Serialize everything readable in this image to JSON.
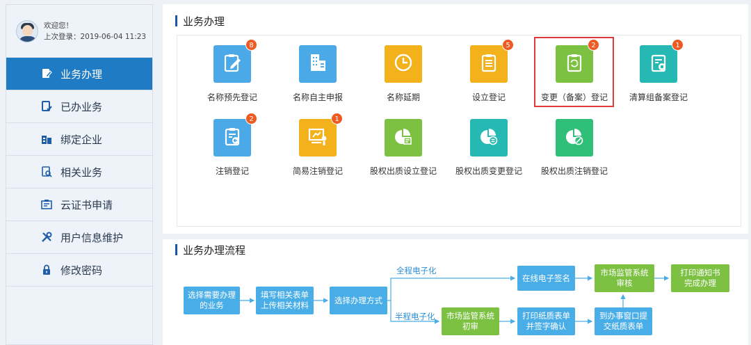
{
  "user": {
    "welcome": "欢迎您！",
    "last_login": "上次登录：2019-06-04 11:23"
  },
  "sidebar": {
    "items": [
      {
        "label": "业务办理",
        "icon": "business-icon",
        "active": true
      },
      {
        "label": "已办业务",
        "icon": "done-icon",
        "active": false
      },
      {
        "label": "绑定企业",
        "icon": "bind-company-icon",
        "active": false
      },
      {
        "label": "相关业务",
        "icon": "related-icon",
        "active": false
      },
      {
        "label": "云证书申请",
        "icon": "cert-icon",
        "active": false
      },
      {
        "label": "用户信息维护",
        "icon": "tools-icon",
        "active": false
      },
      {
        "label": "修改密码",
        "icon": "lock-icon",
        "active": false
      }
    ]
  },
  "business": {
    "title": "业务办理",
    "tiles": [
      {
        "label": "名称预先登记",
        "badge": "8",
        "color": "#4aa9e6",
        "icon": "clipboard-pen-icon"
      },
      {
        "label": "名称自主申报",
        "badge": "",
        "color": "#4aa9e6",
        "icon": "building-icon"
      },
      {
        "label": "名称延期",
        "badge": "",
        "color": "#f3b11b",
        "icon": "clock-icon"
      },
      {
        "label": "设立登记",
        "badge": "5",
        "color": "#f3b11b",
        "icon": "clipboard-list-icon"
      },
      {
        "label": "变更（备案）登记",
        "badge": "2",
        "color": "#7cc142",
        "icon": "clipboard-refresh-icon"
      },
      {
        "label": "清算组备案登记",
        "badge": "1",
        "color": "#26b9b4",
        "icon": "doc-stamp-icon"
      },
      {
        "label": "注销登记",
        "badge": "2",
        "color": "#4aa9e6",
        "icon": "doc-back-icon"
      },
      {
        "label": "简易注销登记",
        "badge": "1",
        "color": "#f3b11b",
        "icon": "board-arrow-icon"
      },
      {
        "label": "股权出质设立登记",
        "badge": "",
        "color": "#7cc142",
        "icon": "pie-doc-icon"
      },
      {
        "label": "股权出质变更登记",
        "badge": "",
        "color": "#26b9b4",
        "icon": "pie-equal-icon"
      },
      {
        "label": "股权出质注销登记",
        "badge": "",
        "color": "#2fbf78",
        "icon": "pie-cancel-icon"
      }
    ]
  },
  "flow": {
    "title": "业务办理流程",
    "branch_full": "全程电子化",
    "branch_half": "半程电子化",
    "nodes": {
      "select_business": "选择需要办理的业务",
      "fill_forms": "填写相关表单上传相关材料",
      "choose_method": "选择办理方式",
      "online_sign": "在线电子签名",
      "market_review": "市场监管系统审核",
      "print_notice": "打印通知书完成办理",
      "market_initial": "市场监管系统初审",
      "print_paper": "打印纸质表单并签字确认",
      "submit_window": "到办事窗口提交纸质表单"
    }
  }
}
